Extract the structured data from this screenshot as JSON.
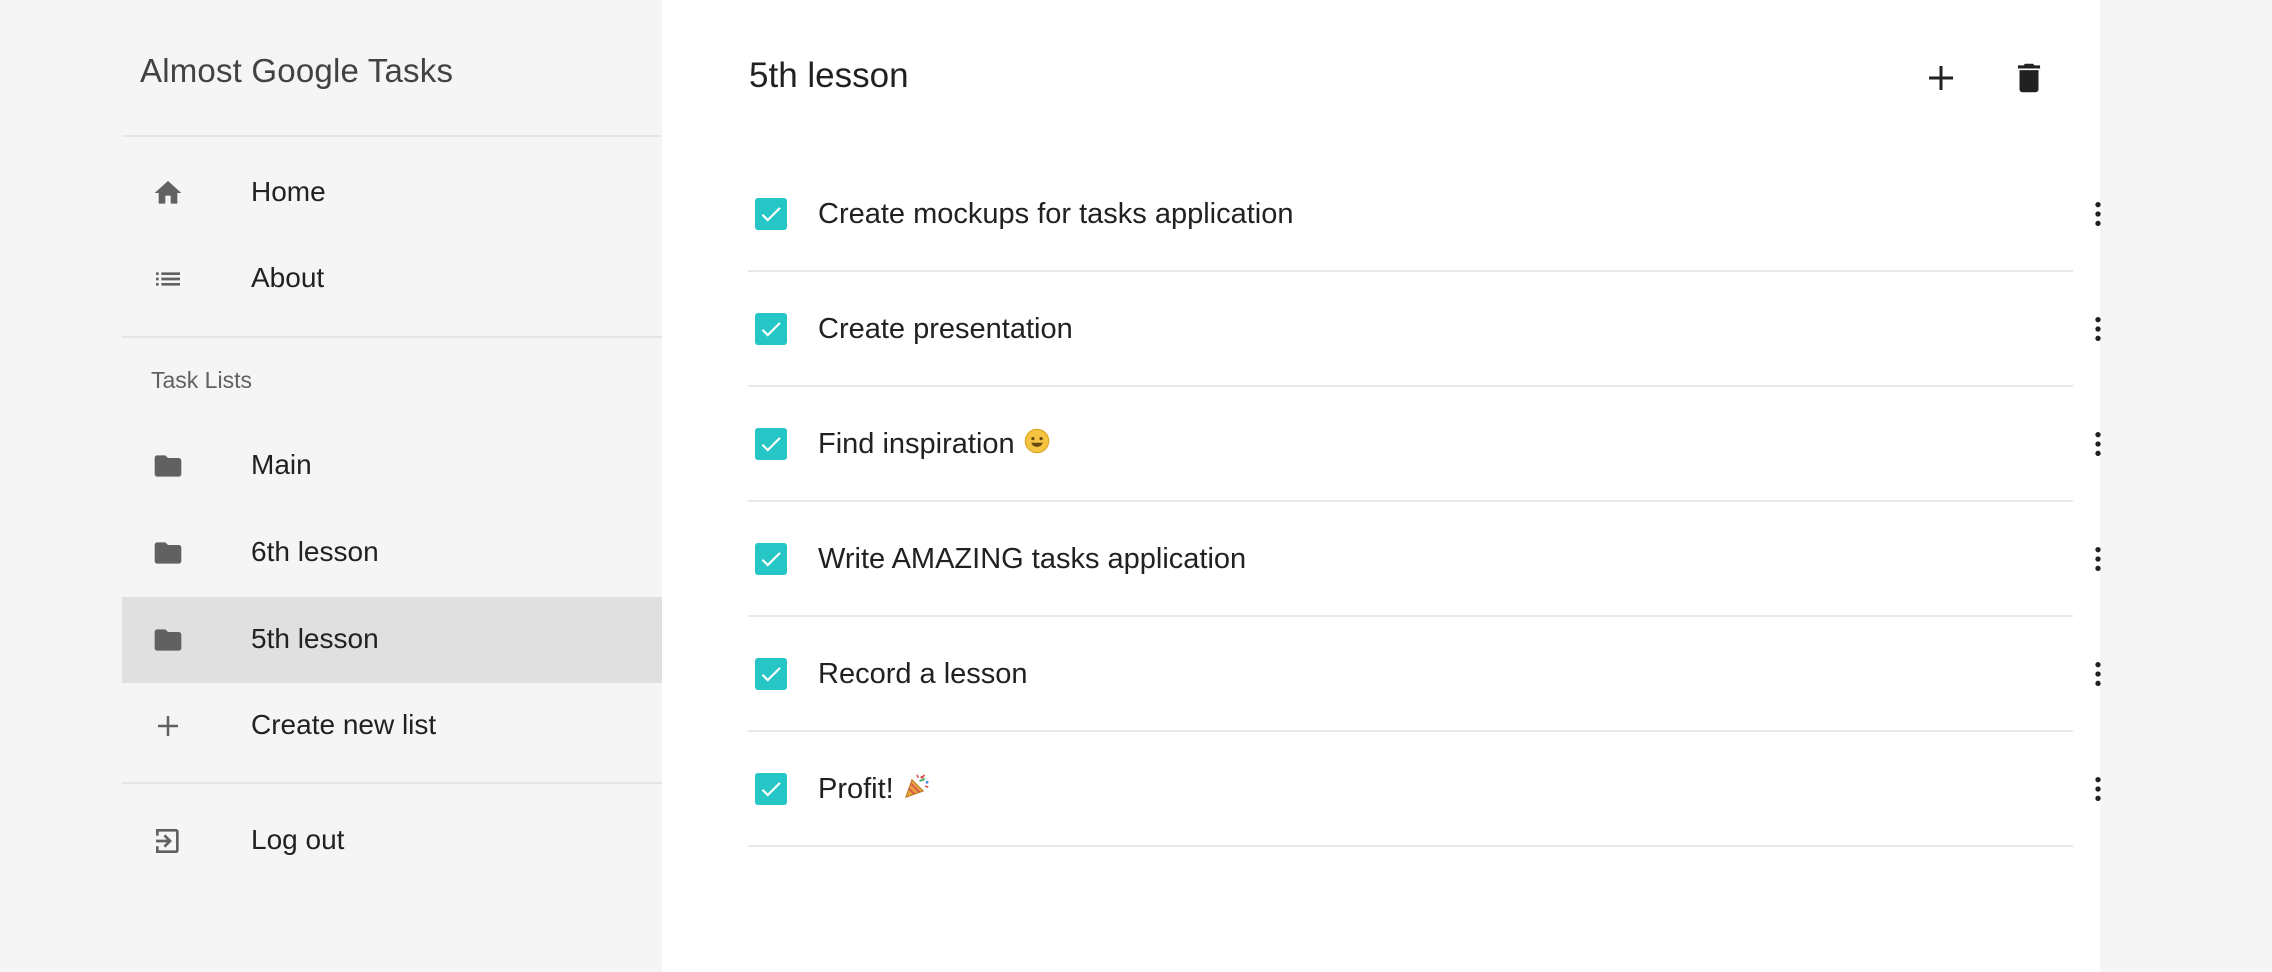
{
  "sidebar": {
    "app_title": "Almost Google Tasks",
    "nav": [
      {
        "label": "Home",
        "icon": "home-icon"
      },
      {
        "label": "About",
        "icon": "list-icon"
      }
    ],
    "section_label": "Task Lists",
    "lists": [
      {
        "label": "Main",
        "icon": "folder-icon",
        "selected": false
      },
      {
        "label": "6th lesson",
        "icon": "folder-icon",
        "selected": false
      },
      {
        "label": "5th lesson",
        "icon": "folder-icon",
        "selected": true
      }
    ],
    "create_label": "Create new list",
    "logout_label": "Log out"
  },
  "main": {
    "title": "5th lesson",
    "tasks": [
      {
        "text": "Create mockups for tasks application",
        "done": true
      },
      {
        "text": "Create presentation",
        "done": true
      },
      {
        "text": "Find inspiration",
        "emoji": "smile-emoji",
        "done": true
      },
      {
        "text": "Write AMAZING tasks application",
        "done": true
      },
      {
        "text": "Record a lesson",
        "done": true
      },
      {
        "text": "Profit!",
        "emoji": "party-popper-emoji",
        "done": true
      }
    ]
  },
  "colors": {
    "accent": "#26c6c6",
    "selected_bg": "#e0e0e0",
    "sidebar_bg": "#f5f5f5"
  }
}
